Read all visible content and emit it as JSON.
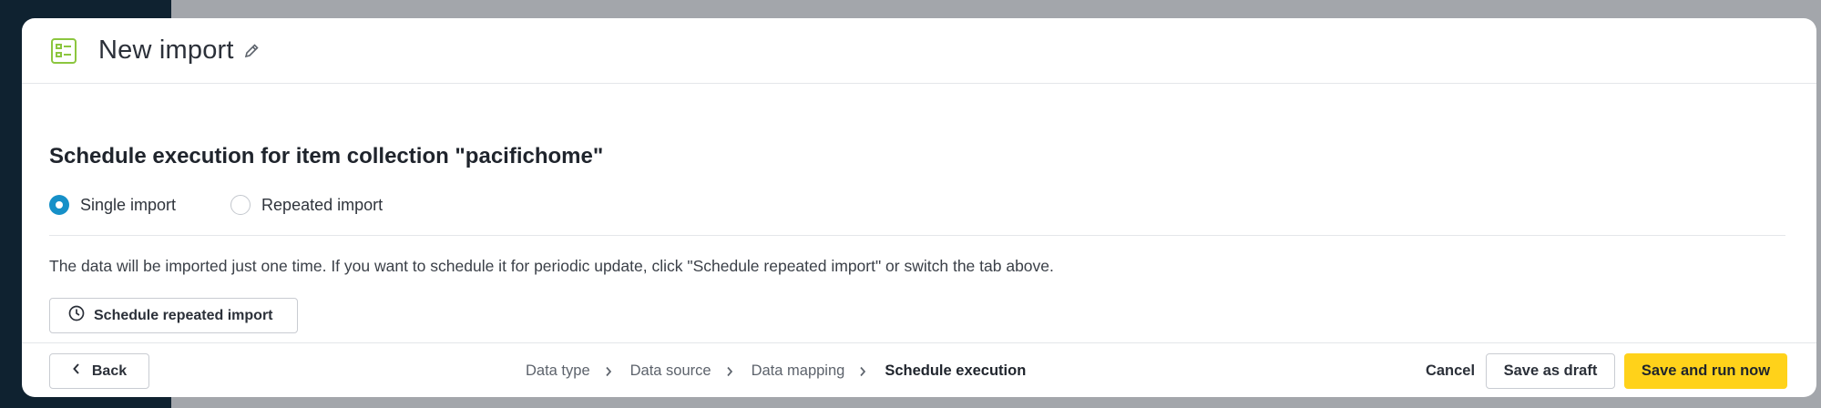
{
  "colors": {
    "accent_radio": "#1690c8",
    "primary_button": "#ffd21a",
    "header_icon": "#8cc63f",
    "sidebar_dark": "#0f2230",
    "overlay_grey": "#a3a6ab"
  },
  "header": {
    "title": "New import",
    "icon": "import-list-icon",
    "edit_icon": "pencil-icon"
  },
  "main": {
    "section_title": "Schedule execution for item collection \"pacifichome\"",
    "options": [
      {
        "label": "Single import",
        "selected": true
      },
      {
        "label": "Repeated import",
        "selected": false
      }
    ],
    "info_text": "The data will be imported just one time. If you want to schedule it for periodic update, click \"Schedule repeated import\" or switch the tab above.",
    "schedule_button": {
      "label": "Schedule repeated import",
      "icon": "clock-icon"
    }
  },
  "footer": {
    "back_label": "Back",
    "steps": [
      {
        "label": "Data type",
        "active": false
      },
      {
        "label": "Data source",
        "active": false
      },
      {
        "label": "Data mapping",
        "active": false
      },
      {
        "label": "Schedule execution",
        "active": true
      }
    ],
    "cancel_label": "Cancel",
    "draft_label": "Save as draft",
    "run_label": "Save and run now"
  }
}
